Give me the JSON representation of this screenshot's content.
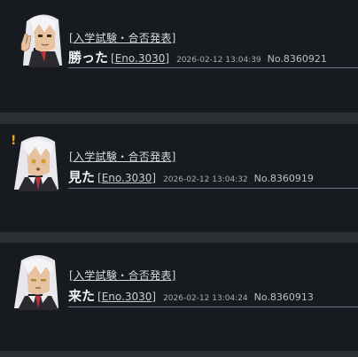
{
  "posts": [
    {
      "title": "[入学試験・合否発表]",
      "message": "勝った",
      "eno": "[Eno.3030]",
      "timestamp": "2026-02-12 13:04:39",
      "number": "No.8360921",
      "avatar": "character-peace-sign-icon"
    },
    {
      "title": "[入学試験・合否発表]",
      "message": "見た",
      "eno": "[Eno.3030]",
      "timestamp": "2026-02-12 13:04:32",
      "number": "No.8360919",
      "alert": "!",
      "avatar": "character-surprised-icon"
    },
    {
      "title": "[入学試験・合否発表]",
      "message": "来た",
      "eno": "[Eno.3030]",
      "timestamp": "2026-02-12 13:04:24",
      "number": "No.8360913",
      "avatar": "character-neutral-icon"
    }
  ],
  "colors": {
    "page_bg": "#2b3035",
    "card_bg": "#171b1f",
    "alert": "#f0a020",
    "rule": "#6f767c"
  }
}
